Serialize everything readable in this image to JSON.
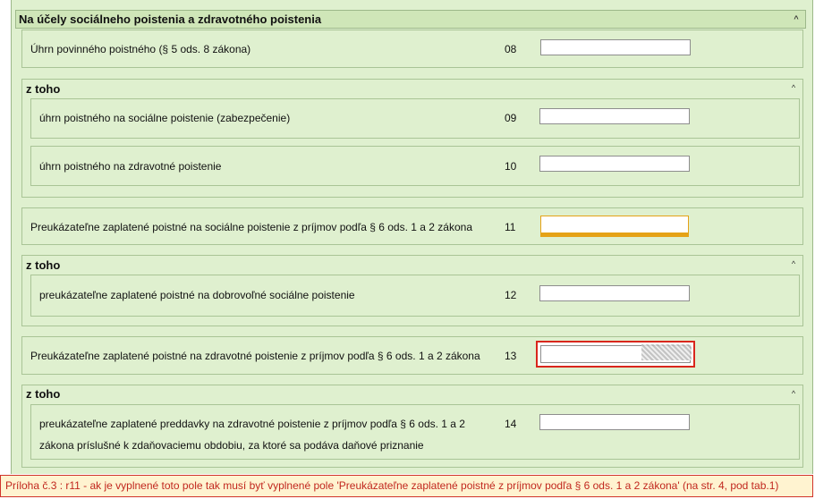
{
  "section": {
    "title": "Na účely sociálneho poistenia a zdravotného poistenia",
    "caret": "^"
  },
  "rows": {
    "r08": {
      "label": "Úhrn povinného poistného (§ 5 ods. 8 zákona)",
      "num": "08",
      "value": ""
    },
    "sub1": {
      "title": "z toho",
      "caret": "^"
    },
    "r09": {
      "label": "úhrn poistného na sociálne poistenie (zabezpečenie)",
      "num": "09",
      "value": ""
    },
    "r10": {
      "label": "úhrn poistného na zdravotné poistenie",
      "num": "10",
      "value": ""
    },
    "r11": {
      "label": "Preukázateľne zaplatené poistné na sociálne poistenie z príjmov podľa § 6 ods. 1 a 2 zákona",
      "num": "11",
      "value": ""
    },
    "sub2": {
      "title": "z toho",
      "caret": "^"
    },
    "r12": {
      "label": "preukázateľne zaplatené poistné na dobrovoľné sociálne poistenie",
      "num": "12",
      "value": ""
    },
    "r13": {
      "label": "Preukázateľne zaplatené poistné na zdravotné poistenie z príjmov podľa § 6 ods. 1 a 2 zákona",
      "num": "13",
      "value": ""
    },
    "sub3": {
      "title": "z toho",
      "caret": "^"
    },
    "r14": {
      "label_line1": "preukázateľne zaplatené preddavky na zdravotné poistenie z príjmov podľa § 6 ods. 1 a 2",
      "label_line2": "zákona príslušné k zdaňovaciemu obdobiu, za ktoré sa podáva daňové priznanie",
      "num": "14",
      "value": ""
    }
  },
  "footer": {
    "message": "Príloha č.3 : r11 - ak je vyplnené toto pole tak musí byť vyplnené pole 'Preukázateľne zaplatené poistné z príjmov podľa § 6 ods. 1 a 2 zákona' (na str. 4, pod tab.1)"
  },
  "colors": {
    "panel": "#dff0cf",
    "header": "#cfe6b8",
    "warning": "#e5a216",
    "error": "#d9261c"
  }
}
